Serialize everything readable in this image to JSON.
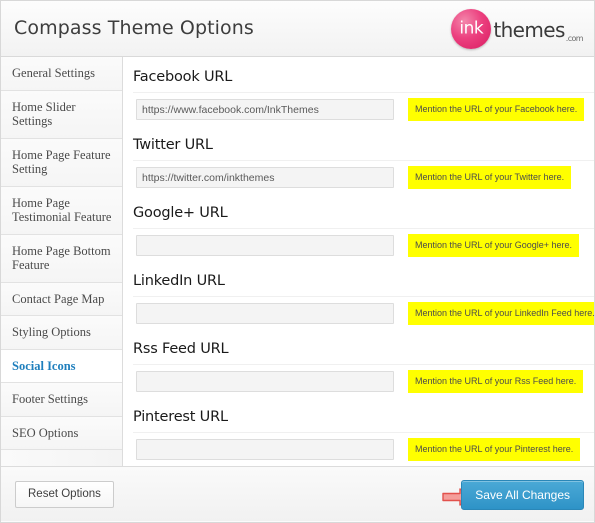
{
  "header": {
    "title": "Compass Theme Options",
    "logo": {
      "mark_text": "ink",
      "word": "themes",
      "tld": ".com",
      "circle_color": "#ec407f"
    }
  },
  "sidebar": {
    "items": [
      {
        "label": "General Settings",
        "active": false
      },
      {
        "label": "Home Slider Settings",
        "active": false
      },
      {
        "label": "Home Page Feature Setting",
        "active": false
      },
      {
        "label": "Home Page Testimonial Feature",
        "active": false
      },
      {
        "label": "Home Page Bottom Feature",
        "active": false
      },
      {
        "label": "Contact Page Map",
        "active": false
      },
      {
        "label": "Styling Options",
        "active": false
      },
      {
        "label": "Social Icons",
        "active": true
      },
      {
        "label": "Footer Settings",
        "active": false
      },
      {
        "label": "SEO Options",
        "active": false
      }
    ],
    "active_color": "#1f7fbd"
  },
  "main": {
    "fields": [
      {
        "title": "Facebook URL",
        "value": "https://www.facebook.com/InkThemes",
        "placeholder": "",
        "hint": "Mention the URL of your Facebook here."
      },
      {
        "title": "Twitter URL",
        "value": "https://twitter.com/inkthemes",
        "placeholder": "",
        "hint": "Mention the URL of your Twitter here."
      },
      {
        "title": "Google+ URL",
        "value": "",
        "placeholder": "",
        "hint": "Mention the URL of your Google+ here."
      },
      {
        "title": "LinkedIn URL",
        "value": "",
        "placeholder": "",
        "hint": "Mention the URL of your LinkedIn Feed here."
      },
      {
        "title": "Rss Feed URL",
        "value": "",
        "placeholder": "",
        "hint": "Mention the URL of your Rss Feed here."
      },
      {
        "title": "Pinterest URL",
        "value": "",
        "placeholder": "",
        "hint": "Mention the URL of your Pinterest here."
      }
    ],
    "hint_bg_color": "#ffff00"
  },
  "footer": {
    "reset_label": "Reset Options",
    "save_label": "Save All Changes",
    "save_color": "#2e93c7",
    "arrow_color": "#f2938f"
  }
}
